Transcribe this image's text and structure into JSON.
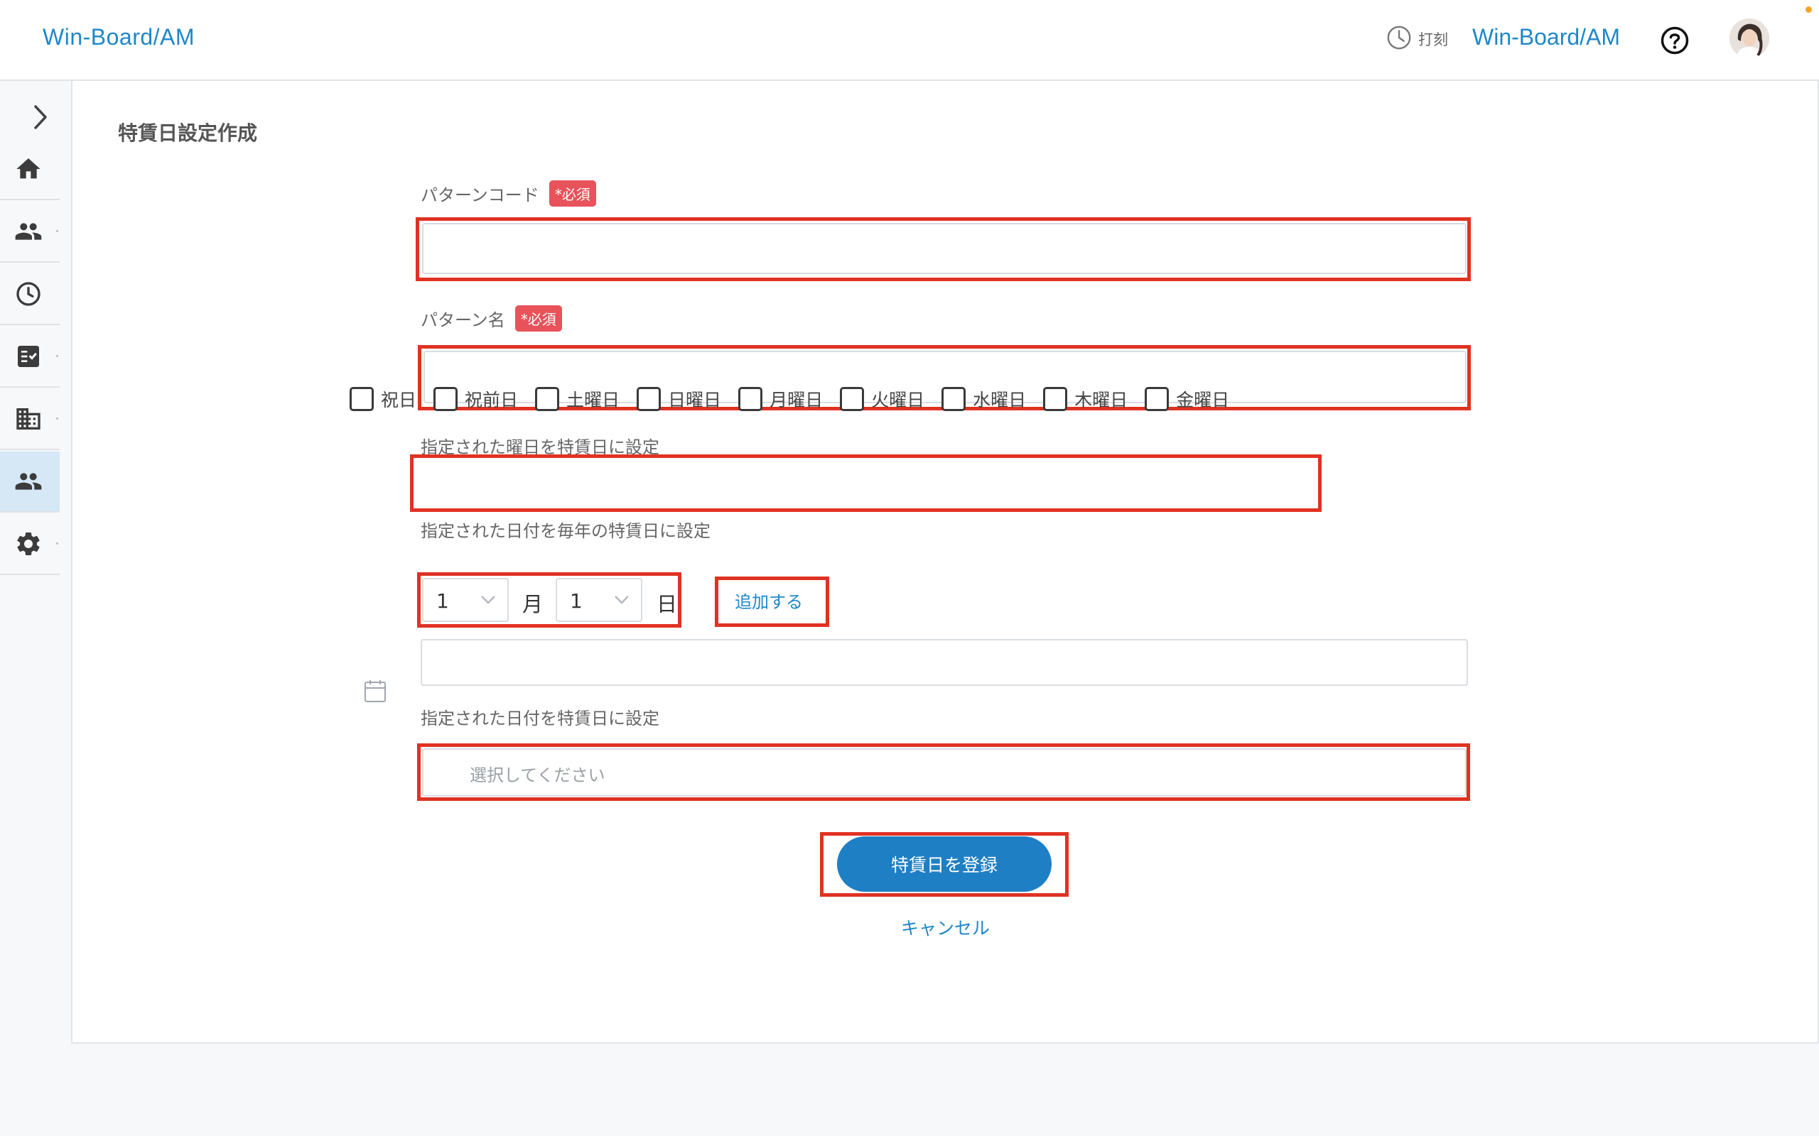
{
  "header": {
    "brand": "Win-Board/AM",
    "clock_label": "打刻",
    "app_name": "Win-Board/AM"
  },
  "sidebar": {
    "items": [
      {
        "icon": "home-icon"
      },
      {
        "icon": "users-icon"
      },
      {
        "icon": "clock-icon"
      },
      {
        "icon": "task-list-icon"
      },
      {
        "icon": "building-icon"
      },
      {
        "icon": "group-icon",
        "active": true
      },
      {
        "icon": "gear-icon"
      }
    ]
  },
  "page": {
    "title": "特賃日設定作成"
  },
  "form": {
    "pattern_code_label": "パターンコード",
    "pattern_name_label": "パターン名",
    "required_badge": "*必須",
    "pattern_code_value": "",
    "pattern_name_value": "",
    "weekday_section_label": "指定された曜日を特賃日に設定",
    "weekdays": [
      "祝日",
      "祝前日",
      "土曜日",
      "日曜日",
      "月曜日",
      "火曜日",
      "水曜日",
      "木曜日",
      "金曜日"
    ],
    "yearly_section_label": "指定された日付を毎年の特賃日に設定",
    "month_value": "1",
    "month_unit": "月",
    "day_value": "1",
    "day_unit": "日",
    "add_label": "追加する",
    "date_section_label": "指定された日付を特賃日に設定",
    "date_placeholder": "選択してください",
    "submit_label": "特賃日を登録",
    "cancel_label": "キャンセル"
  },
  "colors": {
    "accent": "#1f87c8",
    "primary_button": "#1f7fc4",
    "required_badge": "#e8525b",
    "highlight": "#e03223"
  }
}
